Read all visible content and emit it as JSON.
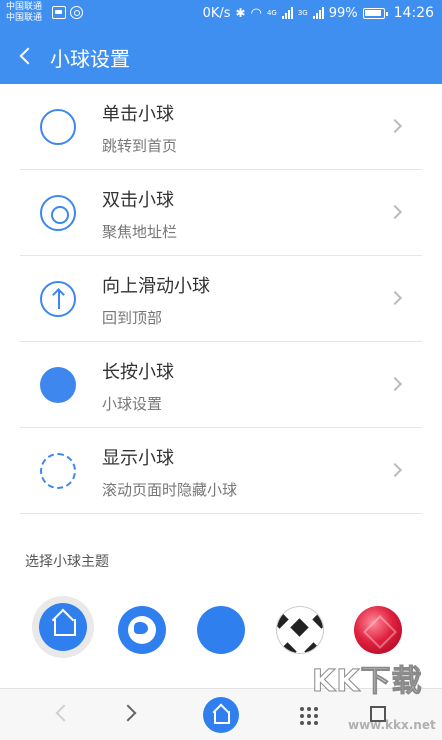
{
  "status_bar": {
    "carrier_1": "中国联通",
    "carrier_2": "中国联通",
    "net_speed": "0K/s",
    "net_4g": "4G",
    "net_3g": "3G",
    "battery": "99%",
    "time": "14:26"
  },
  "header": {
    "title": "小球设置",
    "back_icon": "chevron-left-icon",
    "background_color": "#3f8ff0"
  },
  "settings": [
    {
      "label": "单击小球",
      "sub": "跳转到首页",
      "icon": "ring-icon"
    },
    {
      "label": "双击小球",
      "sub": "聚焦地址栏",
      "icon": "double-ring-icon"
    },
    {
      "label": "向上滑动小球",
      "sub": "回到顶部",
      "icon": "arrow-up-circle-icon"
    },
    {
      "label": "长按小球",
      "sub": "小球设置",
      "icon": "filled-circle-icon"
    },
    {
      "label": "显示小球",
      "sub": "滚动页面时隐藏小球",
      "icon": "dashed-circle-icon"
    }
  ],
  "theme_section": {
    "label": "选择小球主题",
    "themes": [
      {
        "name": "home",
        "icon": "home-icon",
        "selected": true
      },
      {
        "name": "globe",
        "icon": "globe-icon",
        "selected": false
      },
      {
        "name": "plain-blue",
        "icon": "blue-circle-icon",
        "selected": false
      },
      {
        "name": "soccer-ball",
        "icon": "soccer-ball-icon",
        "selected": false
      },
      {
        "name": "ruby",
        "icon": "ruby-icon",
        "selected": false
      }
    ]
  },
  "bottom_nav": {
    "back_icon": "chevron-left-icon",
    "forward_icon": "chevron-right-icon",
    "home_icon": "home-icon",
    "menu_icon": "grid-dots-icon",
    "tabs_icon": "tabs-icon"
  },
  "watermark": {
    "logo_text": "KK下载",
    "url": "www.kkx.net"
  },
  "colors": {
    "accent": "#3e87ef",
    "theme_blue": "#2f7fef"
  }
}
